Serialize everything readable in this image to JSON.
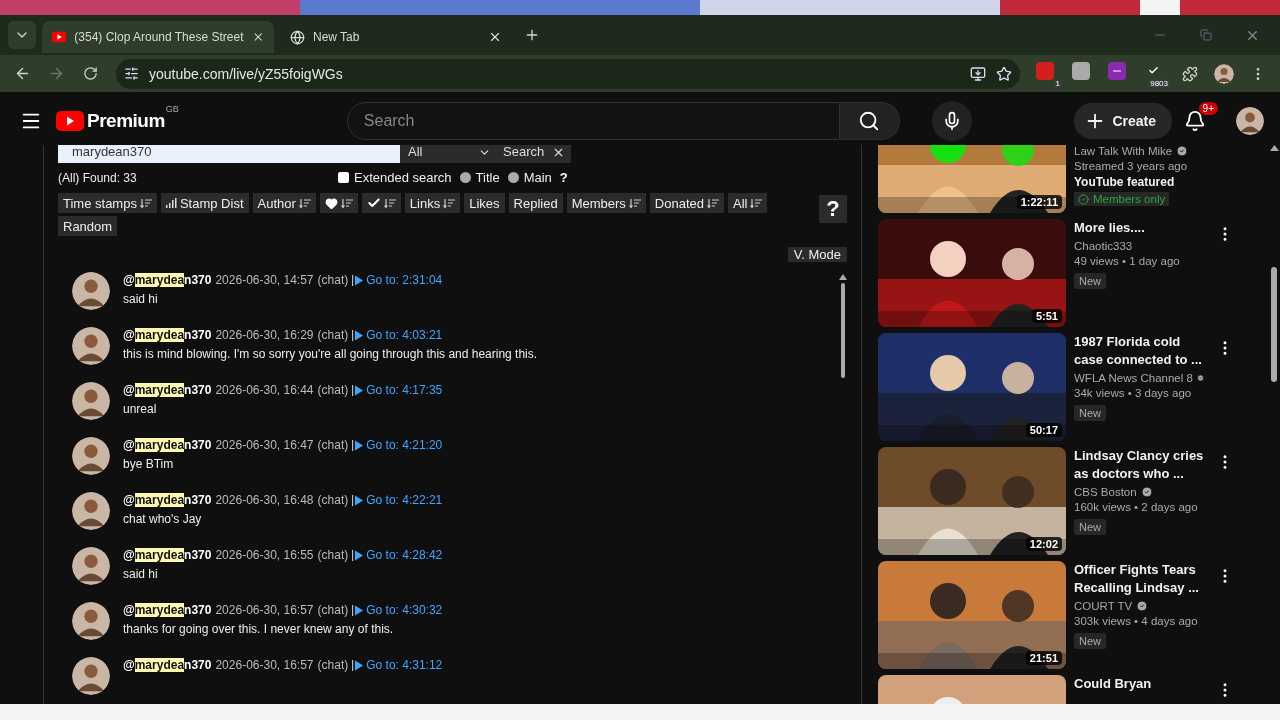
{
  "browser": {
    "tabs": [
      {
        "title": "(354) Clop Around These Street",
        "kind": "youtube",
        "selected": true
      },
      {
        "title": "New Tab",
        "kind": "globe",
        "selected": false
      }
    ],
    "url": "youtube.com/live/yZ55foigWGs",
    "extensions": [
      {
        "kind": "red",
        "badge": "1"
      },
      {
        "kind": "grey"
      },
      {
        "kind": "purple"
      },
      {
        "kind": "check",
        "badge": "9803"
      }
    ]
  },
  "header": {
    "logo": "Premium",
    "region": "GB",
    "search_placeholder": "Search",
    "create": "Create",
    "notifications": "9+"
  },
  "filter": {
    "query": "marydean370",
    "scope": "All",
    "search_button": "Search",
    "found": "(All) Found: 33",
    "options": [
      {
        "kind": "checkbox",
        "label": "Extended search",
        "checked": false
      },
      {
        "kind": "radio",
        "label": "Title",
        "selected": false
      },
      {
        "kind": "radio",
        "label": "Main",
        "selected": false
      }
    ],
    "options_help": "?",
    "sort_buttons": [
      {
        "label": "Time stamps",
        "kind": "text",
        "sort": true
      },
      {
        "label": "Stamp Dist",
        "kind": "bars",
        "sort": false
      },
      {
        "label": "Author",
        "kind": "text",
        "sort": true
      },
      {
        "kind": "heart",
        "sort": true
      },
      {
        "kind": "check",
        "sort": true
      },
      {
        "label": "Links",
        "kind": "text",
        "sort": true
      },
      {
        "label": "Likes",
        "kind": "text",
        "sort": false
      },
      {
        "label": "Replied",
        "kind": "text",
        "sort": false
      },
      {
        "label": "Members",
        "kind": "text",
        "sort": true
      },
      {
        "label": "Donated",
        "kind": "text",
        "sort": true
      },
      {
        "label": "All",
        "kind": "text",
        "sort": true
      },
      {
        "label": "Random",
        "kind": "text",
        "sort": false
      }
    ],
    "help": "?",
    "view_mode": "V. Mode"
  },
  "comments": [
    {
      "prefix": "@",
      "match": "marydea",
      "suffix": "n370",
      "date": "2026-06-30, 14:57",
      "source": "(chat)",
      "goto": "Go to: 2:31:04",
      "text": "said hi"
    },
    {
      "prefix": "@",
      "match": "marydea",
      "suffix": "n370",
      "date": "2026-06-30, 16:29",
      "source": "(chat)",
      "goto": "Go to: 4:03:21",
      "text": "this is mind blowing. I'm so sorry you're all going through this and hearing this."
    },
    {
      "prefix": "@",
      "match": "marydea",
      "suffix": "n370",
      "date": "2026-06-30, 16:44",
      "source": "(chat)",
      "goto": "Go to: 4:17:35",
      "text": "unreal"
    },
    {
      "prefix": "@",
      "match": "marydea",
      "suffix": "n370",
      "date": "2026-06-30, 16:47",
      "source": "(chat)",
      "goto": "Go to: 4:21:20",
      "text": "bye BTim"
    },
    {
      "prefix": "@",
      "match": "marydea",
      "suffix": "n370",
      "date": "2026-06-30, 16:48",
      "source": "(chat)",
      "goto": "Go to: 4:22:21",
      "text": "chat who's Jay"
    },
    {
      "prefix": "@",
      "match": "marydea",
      "suffix": "n370",
      "date": "2026-06-30, 16:55",
      "source": "(chat)",
      "goto": "Go to: 4:28:42",
      "text": "said hi"
    },
    {
      "prefix": "@",
      "match": "marydea",
      "suffix": "n370",
      "date": "2026-06-30, 16:57",
      "source": "(chat)",
      "goto": "Go to: 4:30:32",
      "text": "thanks for going over this. I never knew any of this."
    },
    {
      "prefix": "@",
      "match": "marydea",
      "suffix": "n370",
      "date": "2026-06-30, 16:57",
      "source": "(chat)",
      "goto": "Go to: 4:31:12"
    }
  ],
  "related": [
    {
      "kind": "picture",
      "duration": "1:22:11",
      "channel": "Law Talk With Mike",
      "verified": true,
      "meta": "Streamed 3 years ago",
      "featured": "YouTube featured",
      "members": "Members only"
    },
    {
      "kind": "picture",
      "duration": "5:51",
      "title": "More lies....",
      "channel": "Chaotic333",
      "verified": false,
      "meta": "49 views • 1 day ago",
      "badge": "New"
    },
    {
      "kind": "picture",
      "duration": "50:17",
      "title": "1987 Florida cold case connected to ...",
      "channel": "WFLA News Channel 8",
      "verified": true,
      "meta": "34k views • 3 days ago",
      "badge": "New"
    },
    {
      "kind": "picture",
      "duration": "12:02",
      "title": "Lindsay Clancy cries as doctors who ...",
      "channel": "CBS Boston",
      "verified": true,
      "meta": "160k views • 2 days ago",
      "badge": "New"
    },
    {
      "kind": "picture",
      "duration": "21:51",
      "title": "Officer Fights Tears Recalling Lindsay ...",
      "channel": "COURT TV",
      "verified": true,
      "meta": "303k views • 4 days ago",
      "badge": "New"
    },
    {
      "kind": "picture",
      "title": "Could Bryan"
    }
  ]
}
